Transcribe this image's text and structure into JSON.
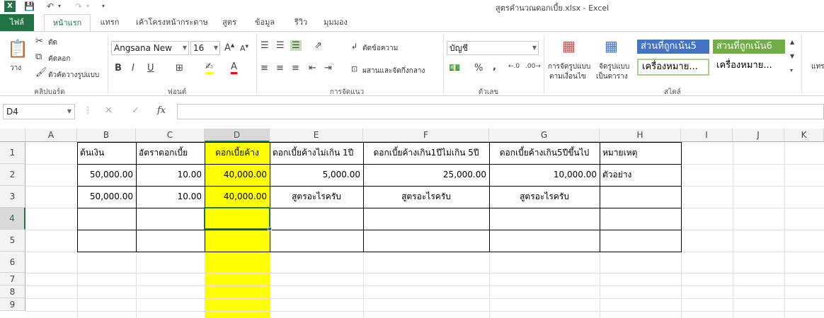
{
  "window": {
    "title": "สูตรคำนวณดอกเบี้ย.xlsx - Excel",
    "logo": "X",
    "quick_access": [
      "save-icon",
      "undo-icon",
      "redo-icon"
    ]
  },
  "tabs": [
    {
      "label": "ไฟล์"
    },
    {
      "label": "หน้าแรก"
    },
    {
      "label": "แทรก"
    },
    {
      "label": "เค้าโครงหน้ากระดาษ"
    },
    {
      "label": "สูตร"
    },
    {
      "label": "ข้อมูล"
    },
    {
      "label": "รีวิว"
    },
    {
      "label": "มุมมอง"
    }
  ],
  "ribbon": {
    "clipboard": {
      "paste": "วาง",
      "cut": "ตัด",
      "copy": "คัดลอก",
      "format_painter": "ตัวคัดวางรูปแบบ",
      "label": "คลิปบอร์ด"
    },
    "font": {
      "name": "Angsana New",
      "size": "16",
      "bold": "B",
      "italic": "I",
      "underline": "U",
      "label": "ฟอนต์"
    },
    "alignment": {
      "wrap": "ตัดข้อความ",
      "merge": "ผสานและจัดกึ่งกลาง",
      "label": "การจัดแนว"
    },
    "number": {
      "format": "บัญชี",
      "percent": "%",
      "comma": ",",
      "label": "ตัวเลข"
    },
    "styles": {
      "conditional_1": "การจัดรูปแบบ",
      "conditional_2": "ตามเงื่อนไข",
      "table_1": "จัดรูปแบบ",
      "table_2": "เป็นตาราง",
      "accent5": "ส่วนที่ถูกเน้น5",
      "accent6": "ส่วนที่ถูกเน้น6",
      "comma_style_1": "เครื่องหมาย...",
      "comma_style_2": "เครื่องหมาย...",
      "label": "สไตล์",
      "accent5_color": "#4472c4",
      "accent6_color": "#70ad47"
    },
    "insert": "แทร"
  },
  "formula_bar": {
    "name_box": "D4",
    "fx": "fx",
    "content": ""
  },
  "sheet": {
    "columns": [
      "A",
      "B",
      "C",
      "D",
      "E",
      "F",
      "G",
      "H",
      "I",
      "J",
      "K"
    ],
    "rows": [
      "1",
      "2",
      "3",
      "4",
      "5",
      "6",
      "7",
      "8",
      "9"
    ],
    "selected_col": "D",
    "selected_row": "4",
    "cells": {
      "B1": "ต้นเงิน",
      "C1": "อัตราดอกเบี้ย",
      "D1": "ดอกเบี้ยค้าง",
      "E1": "ดอกเบี้ยค้างไม่เกิน 1ปี",
      "F1": "ดอกเบี้ยค้างเกิน1ปีไม่เกิน 5ปี",
      "G1": "ดอกเบี้ยค้างเกิน5ปีขึ้นไป",
      "H1": "หมายเหตุ",
      "B2": "50,000.00",
      "C2": "10.00",
      "D2": "40,000.00",
      "E2": "5,000.00",
      "F2": "25,000.00",
      "G2": "10,000.00",
      "H2": "ตัวอย่าง",
      "B3": "50,000.00",
      "C3": "10.00",
      "D3": "40,000.00",
      "E3": "สูตรอะไรครับ",
      "F3": "สูตรอะไรครับ",
      "G3": "สูตรอะไรครับ"
    },
    "highlight_color": "#ffff00"
  }
}
